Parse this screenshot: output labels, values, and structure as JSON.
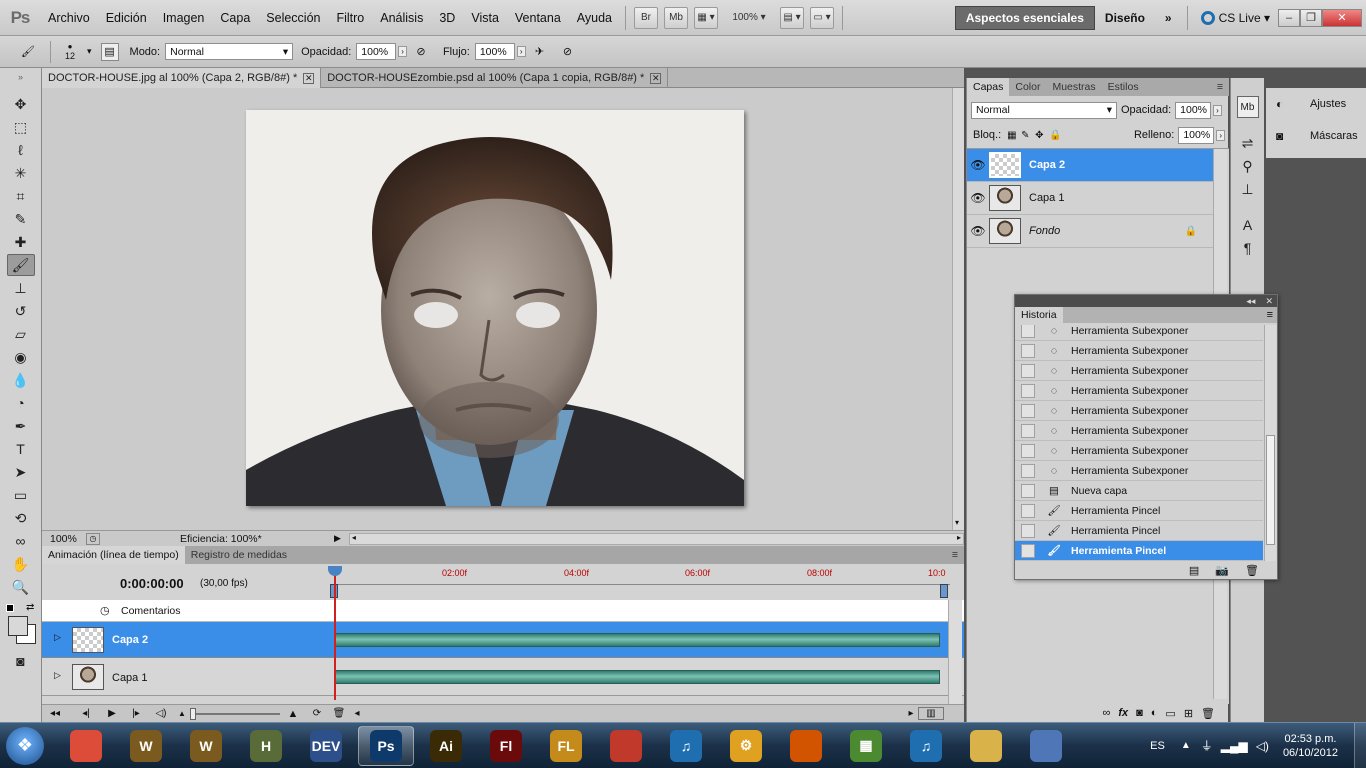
{
  "app": {
    "logo": "Ps"
  },
  "menu": [
    "Archivo",
    "Edición",
    "Imagen",
    "Capa",
    "Selección",
    "Filtro",
    "Análisis",
    "3D",
    "Vista",
    "Ventana",
    "Ayuda"
  ],
  "menubar": {
    "bridge_label": "Br",
    "minibridge_label": "Mb",
    "zoom_value": "100%",
    "workspace_active": "Aspectos esenciales",
    "workspace_design": "Diseño",
    "cslive": "CS Live"
  },
  "options": {
    "brush_size": "12",
    "mode_label": "Modo:",
    "mode_value": "Normal",
    "opacity_label": "Opacidad:",
    "opacity_value": "100%",
    "flow_label": "Flujo:",
    "flow_value": "100%"
  },
  "documents": [
    {
      "title": "DOCTOR-HOUSE.jpg al 100% (Capa 2, RGB/8#) *",
      "active": true
    },
    {
      "title": "DOCTOR-HOUSEzombie.psd al 100% (Capa 1 copia, RGB/8#) *",
      "active": false
    }
  ],
  "status": {
    "zoom": "100%",
    "info": "Eficiencia: 100%*"
  },
  "timeline": {
    "tabs": [
      "Animación (línea de tiempo)",
      "Registro de medidas"
    ],
    "current_time": "0:00:00:00",
    "fps": "(30,00 fps)",
    "ruler": [
      "02:00f",
      "04:00f",
      "06:00f",
      "08:00f",
      "10:0"
    ],
    "comments_label": "Comentarios",
    "layers": [
      {
        "name": "Capa 2",
        "selected": true
      },
      {
        "name": "Capa 1",
        "selected": false
      }
    ]
  },
  "layers_panel": {
    "tabs": [
      "Capas",
      "Color",
      "Muestras",
      "Estilos"
    ],
    "blend_mode": "Normal",
    "opacity_label": "Opacidad:",
    "opacity_value": "100%",
    "lock_label": "Bloq.:",
    "fill_label": "Relleno:",
    "fill_value": "100%",
    "layers": [
      {
        "name": "Capa 2",
        "selected": true,
        "locked": false
      },
      {
        "name": "Capa 1",
        "selected": false,
        "locked": false
      },
      {
        "name": "Fondo",
        "selected": false,
        "locked": true
      }
    ]
  },
  "adjust_panel": {
    "ajustes": "Ajustes",
    "mascaras": "Máscaras"
  },
  "history": {
    "title": "Historia",
    "items": [
      {
        "label": "Herramienta Subexponer",
        "icon": "dodge"
      },
      {
        "label": "Herramienta Subexponer",
        "icon": "dodge"
      },
      {
        "label": "Herramienta Subexponer",
        "icon": "dodge"
      },
      {
        "label": "Herramienta Subexponer",
        "icon": "dodge"
      },
      {
        "label": "Herramienta Subexponer",
        "icon": "dodge"
      },
      {
        "label": "Herramienta Subexponer",
        "icon": "dodge"
      },
      {
        "label": "Herramienta Subexponer",
        "icon": "dodge"
      },
      {
        "label": "Herramienta Subexponer",
        "icon": "dodge"
      },
      {
        "label": "Nueva capa",
        "icon": "layer"
      },
      {
        "label": "Herramienta Pincel",
        "icon": "brush"
      },
      {
        "label": "Herramienta Pincel",
        "icon": "brush"
      },
      {
        "label": "Herramienta Pincel",
        "icon": "brush"
      }
    ]
  },
  "taskbar": {
    "lang": "ES",
    "time": "02:53 p.m.",
    "date": "06/10/2012",
    "apps": [
      {
        "label": "",
        "color": "#dd4b39",
        "name": "chrome"
      },
      {
        "label": "W",
        "color": "#7a5a1e",
        "name": "wow-1"
      },
      {
        "label": "W",
        "color": "#7a5a1e",
        "name": "wow-2"
      },
      {
        "label": "H",
        "color": "#5a6b3a",
        "name": "halo"
      },
      {
        "label": "DEV",
        "color": "#2d4f8a",
        "name": "devcpp"
      },
      {
        "label": "Ps",
        "color": "#0e3a6b",
        "name": "photoshop",
        "active": true
      },
      {
        "label": "Ai",
        "color": "#3a2a05",
        "name": "illustrator"
      },
      {
        "label": "Fl",
        "color": "#6b0a0a",
        "name": "flash"
      },
      {
        "label": "FL",
        "color": "#c48a1a",
        "name": "flstudio"
      },
      {
        "label": "",
        "color": "#c0392b",
        "name": "app-red"
      },
      {
        "label": "♫",
        "color": "#1f6fb0",
        "name": "itunes"
      },
      {
        "label": "⚙",
        "color": "#e0a020",
        "name": "app-gear"
      },
      {
        "label": "",
        "color": "#d35400",
        "name": "firefox"
      },
      {
        "label": "▦",
        "color": "#4c8a32",
        "name": "minecraft"
      },
      {
        "label": "♫",
        "color": "#1f6fb0",
        "name": "itunes-2"
      },
      {
        "label": "",
        "color": "#d9b24a",
        "name": "explorer"
      },
      {
        "label": "",
        "color": "#4f77b8",
        "name": "paint"
      }
    ]
  }
}
